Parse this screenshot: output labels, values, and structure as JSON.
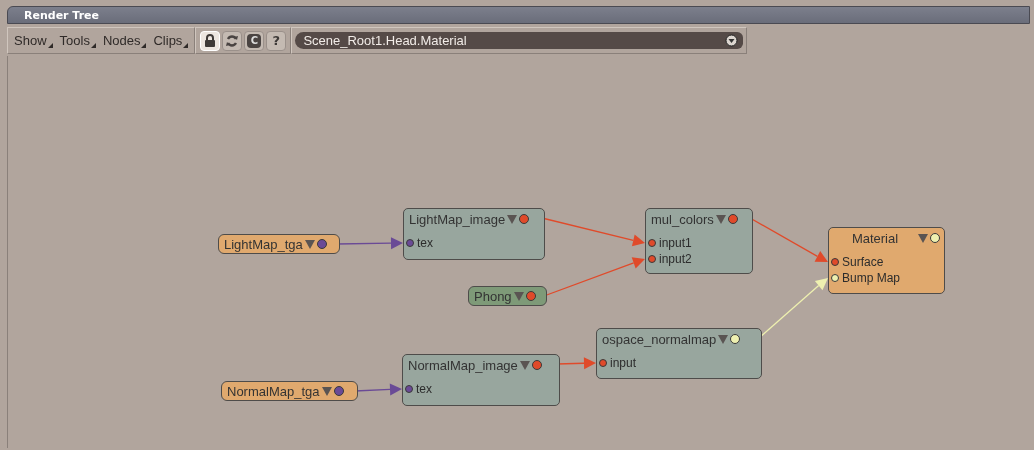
{
  "window": {
    "title": "Render Tree"
  },
  "menus": [
    {
      "label": "Show"
    },
    {
      "label": "Tools"
    },
    {
      "label": "Nodes"
    },
    {
      "label": "Clips"
    }
  ],
  "tool_buttons": [
    {
      "kind": "lock",
      "selected": true
    },
    {
      "kind": "refresh",
      "selected": false
    },
    {
      "kind": "text",
      "label": "C",
      "selected": false
    },
    {
      "kind": "glyph",
      "label": "?",
      "selected": false
    }
  ],
  "path_dropdown": {
    "value": "Scene_Root1.Head.Material"
  },
  "nodes": [
    {
      "title": "LightMap_tga",
      "kind": "pill",
      "color": "#e0a96e",
      "output": {
        "color": "#6a4a96"
      }
    },
    {
      "title": "LightMap_image",
      "kind": "box",
      "color": "#98a69e",
      "output": {
        "color": "#e04a2a"
      },
      "inputs": [
        {
          "label": "tex",
          "color": "#6a4a96"
        }
      ]
    },
    {
      "title": "Phong",
      "kind": "pill",
      "color": "#7e9a78",
      "output": {
        "color": "#e04a2a"
      }
    },
    {
      "title": "mul_colors",
      "kind": "box",
      "color": "#98a69e",
      "output": {
        "color": "#e04a2a"
      },
      "inputs": [
        {
          "label": "input1",
          "color": "#e04a2a"
        },
        {
          "label": "input2",
          "color": "#e04a2a"
        }
      ]
    },
    {
      "title": "Material",
      "kind": "root",
      "color": "#e0a96e",
      "output": {
        "color": "#eef0b0"
      },
      "inputs": [
        {
          "label": "Surface",
          "color": "#e04a2a"
        },
        {
          "label": "Bump Map",
          "color": "#eef0b0"
        }
      ]
    },
    {
      "title": "NormalMap_tga",
      "kind": "pill",
      "color": "#e0a96e",
      "output": {
        "color": "#6a4a96"
      }
    },
    {
      "title": "NormalMap_image",
      "kind": "box",
      "color": "#98a69e",
      "output": {
        "color": "#e04a2a"
      },
      "inputs": [
        {
          "label": "tex",
          "color": "#6a4a96"
        }
      ]
    },
    {
      "title": "ospace_normalmap",
      "kind": "box",
      "color": "#98a69e",
      "output": {
        "color": "#eef0b0"
      },
      "inputs": [
        {
          "label": "input",
          "color": "#e04a2a"
        }
      ]
    }
  ]
}
